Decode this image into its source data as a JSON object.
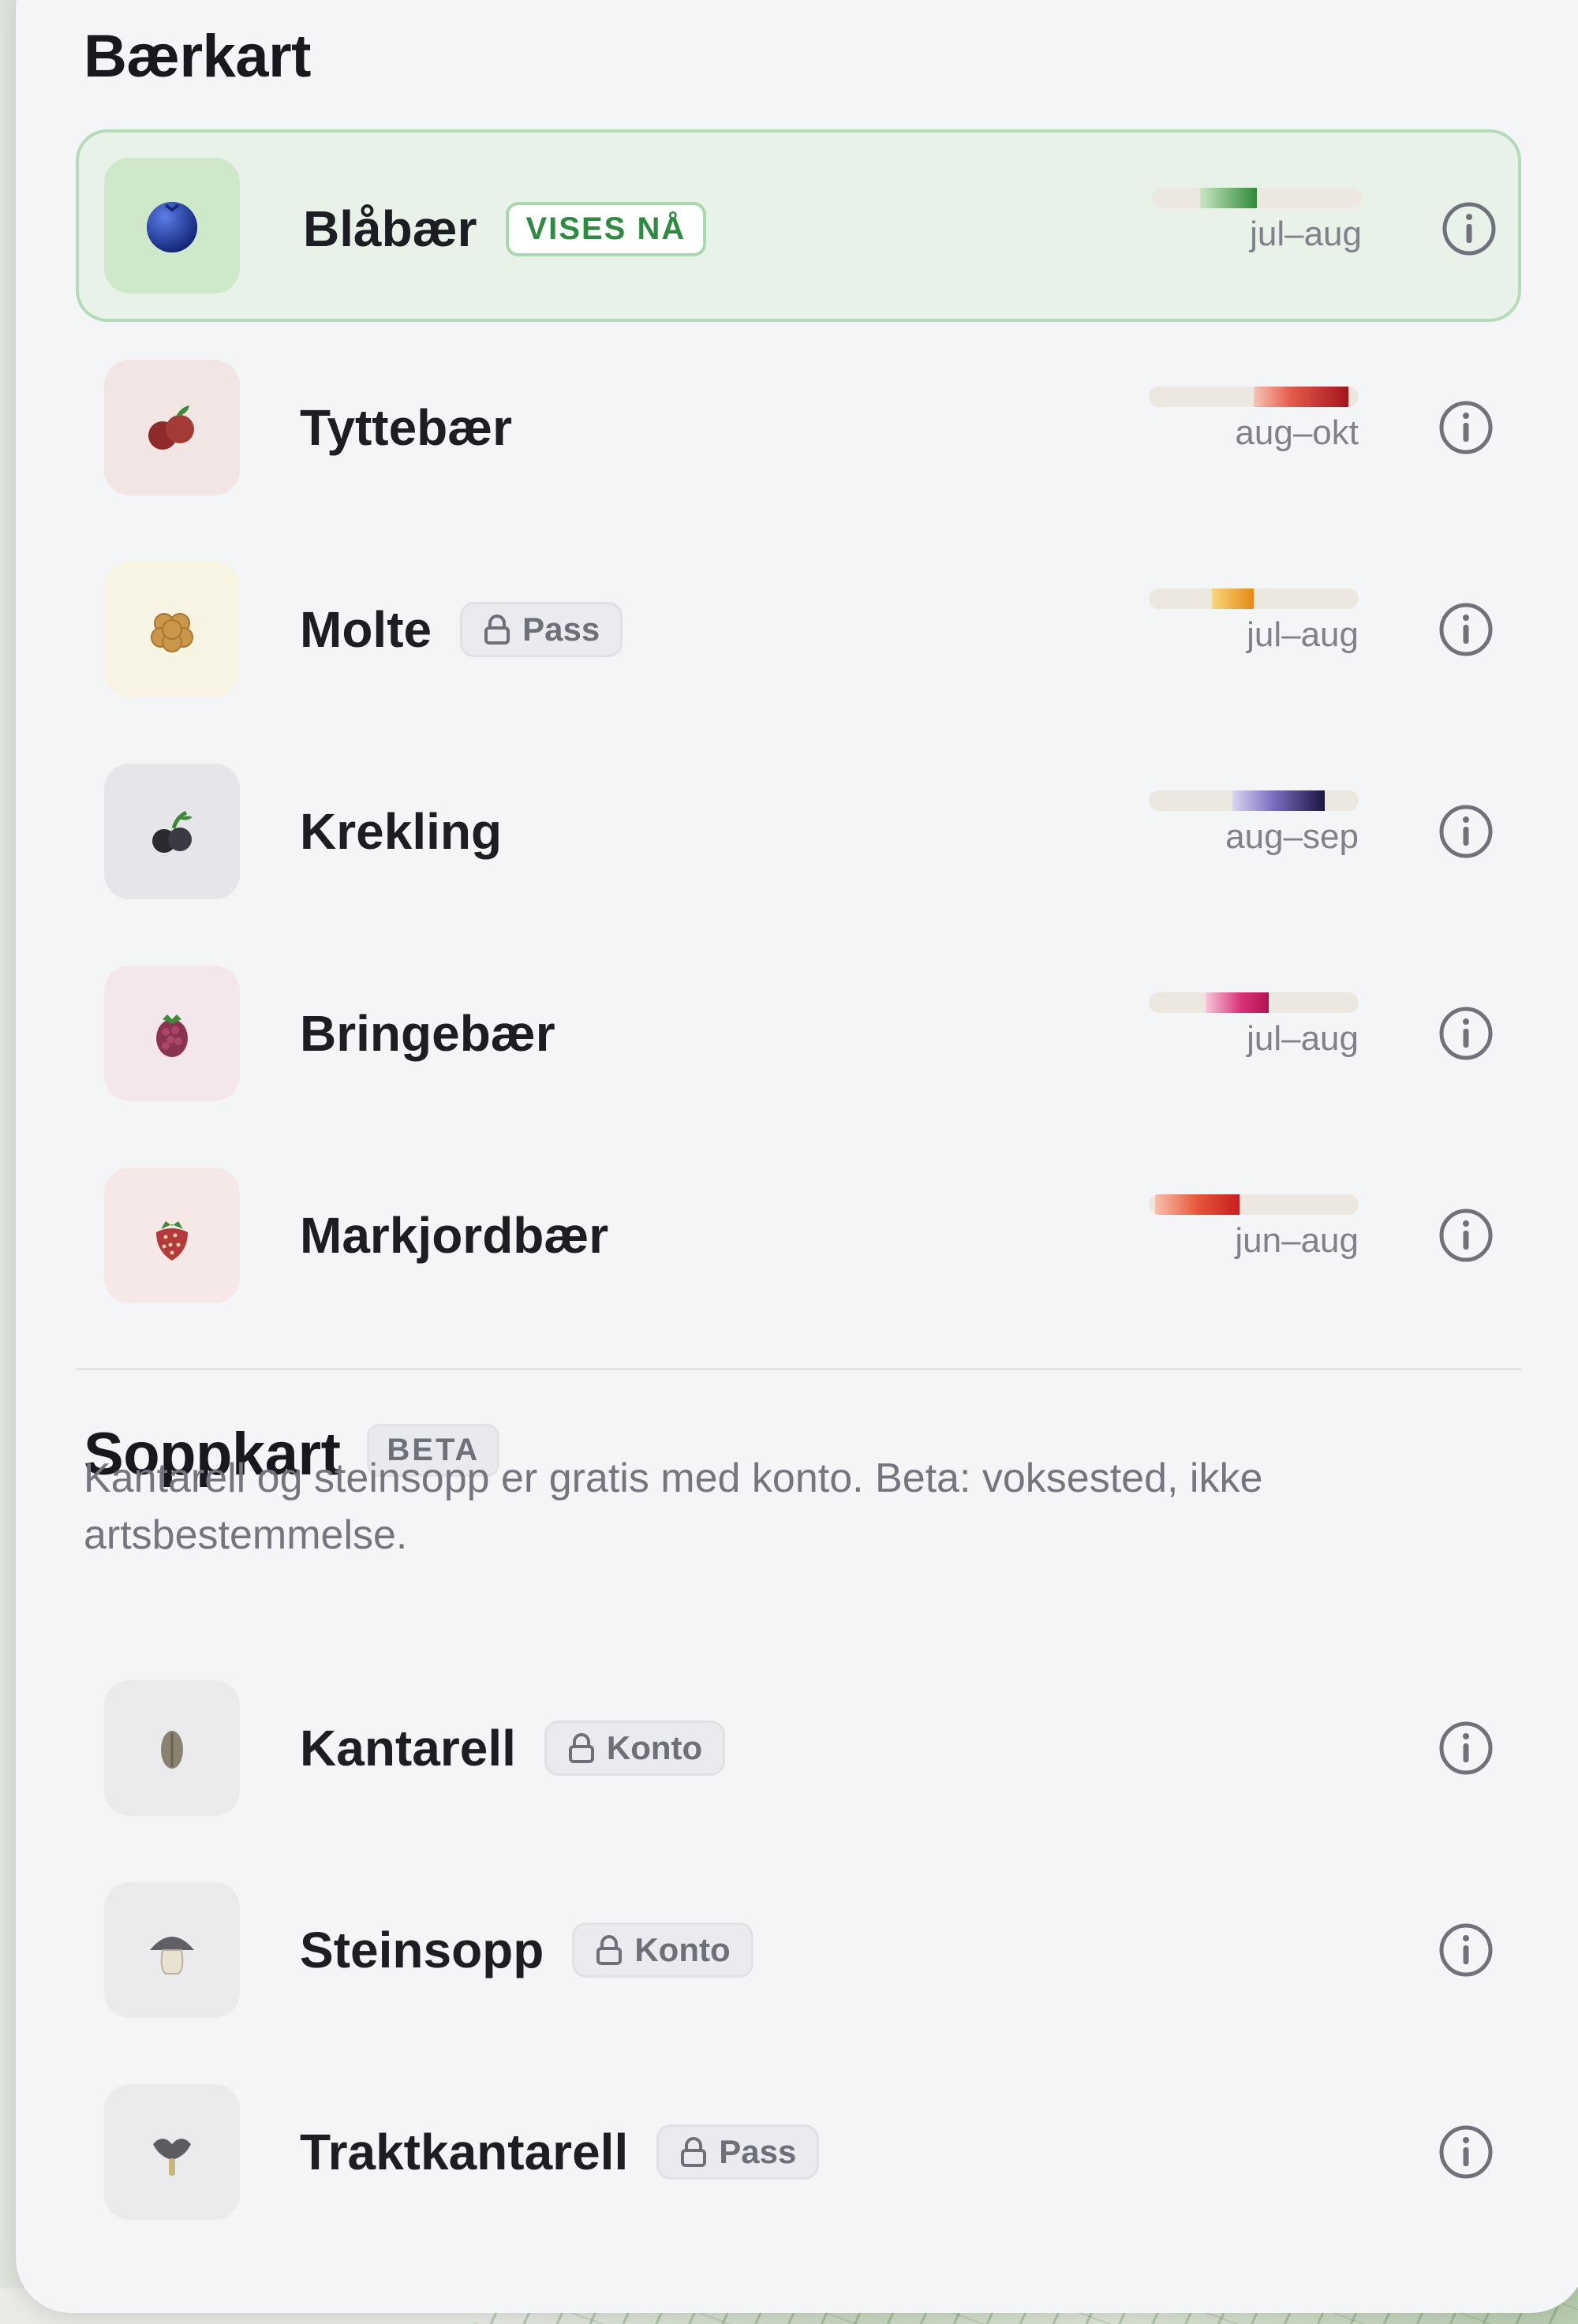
{
  "berries": {
    "title": "Bærkart",
    "items": [
      {
        "name": "Blåbær",
        "badge_now": "VISES NÅ",
        "season": "jul–aug",
        "thumb_bg": "#cfe8c9",
        "fill": [
          "#c9e6c1",
          "#2e8b3a"
        ],
        "fill_from": 0.23,
        "fill_to": 0.5
      },
      {
        "name": "Tyttebær",
        "season": "aug–okt",
        "thumb_bg": "#f2e6e5",
        "fill": [
          "#f5c3b5",
          "#a3151d"
        ],
        "fill_from": 0.5,
        "fill_to": 0.95
      },
      {
        "name": "Molte",
        "lock_label": "Pass",
        "season": "jul–aug",
        "thumb_bg": "#f7f4e4",
        "fill": [
          "#f6c85a",
          "#e58a16"
        ],
        "fill_from": 0.3,
        "fill_to": 0.5
      },
      {
        "name": "Krekling",
        "season": "aug–sep",
        "thumb_bg": "#e6e6ea",
        "fill": [
          "#c9c3e6",
          "#1b1640"
        ],
        "fill_from": 0.4,
        "fill_to": 0.84
      },
      {
        "name": "Bringebær",
        "season": "jul–aug",
        "thumb_bg": "#f3e6ec",
        "fill": [
          "#f4b9cf",
          "#b3124e"
        ],
        "fill_from": 0.27,
        "fill_to": 0.57
      },
      {
        "name": "Markjordbær",
        "season": "jun–aug",
        "thumb_bg": "#f5e8e6",
        "fill": [
          "#f4b0a0",
          "#c81e1e"
        ],
        "fill_from": 0.03,
        "fill_to": 0.43
      }
    ]
  },
  "mushrooms": {
    "title": "Soppkart",
    "beta_label": "BETA",
    "description": "Kantarell og steinsopp er gratis med konto. Beta: voksested, ikke artsbestemmelse.",
    "items": [
      {
        "name": "Kantarell",
        "lock_label": "Konto"
      },
      {
        "name": "Steinsopp",
        "lock_label": "Konto"
      },
      {
        "name": "Traktkantarell",
        "lock_label": "Pass"
      }
    ]
  },
  "colors": {
    "panel_bg": "#f4f5f7",
    "active_bg": "#e8f2e8",
    "active_border": "#b3dbb6",
    "accent_green": "#2f8b42"
  }
}
